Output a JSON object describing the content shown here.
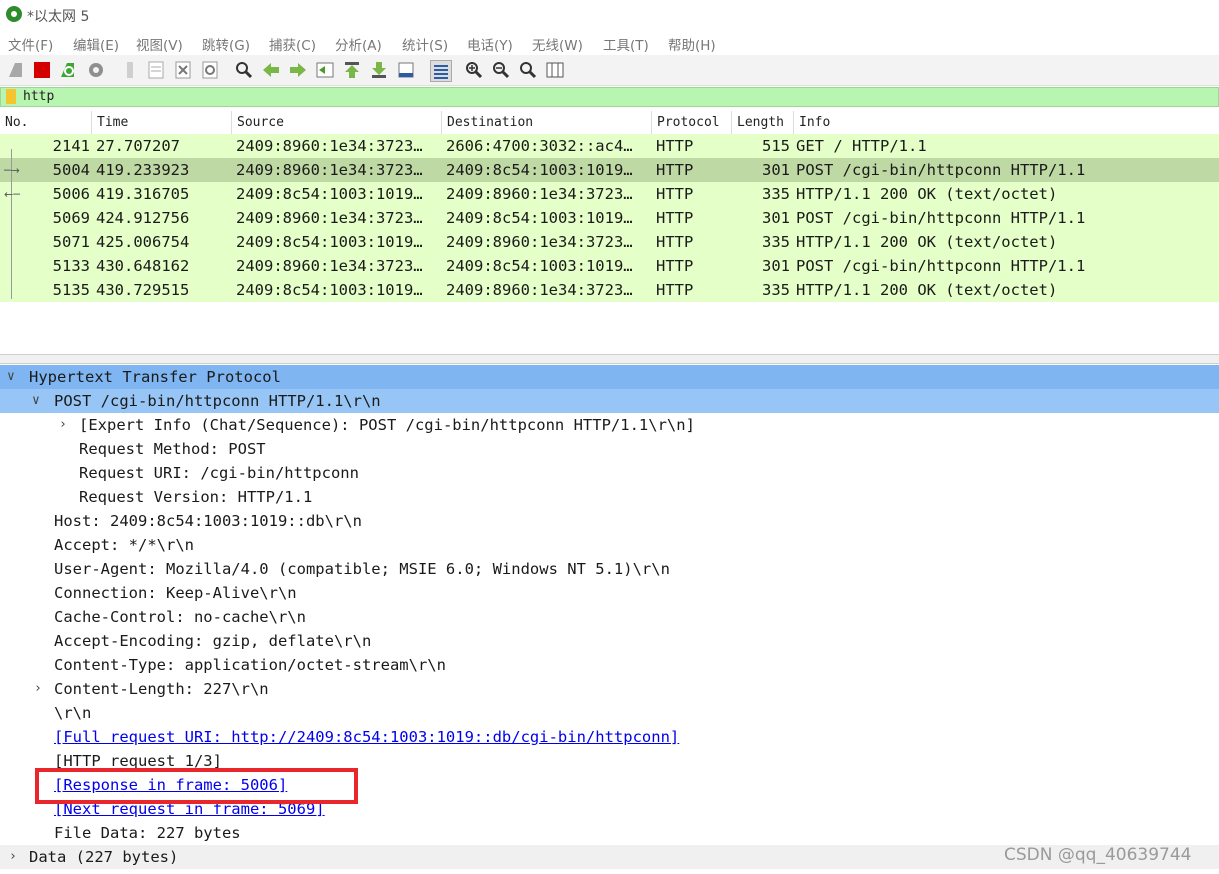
{
  "window": {
    "title": "*以太网 5"
  },
  "menu": [
    "文件(F)",
    "编辑(E)",
    "视图(V)",
    "跳转(G)",
    "捕获(C)",
    "分析(A)",
    "统计(S)",
    "电话(Y)",
    "无线(W)",
    "工具(T)",
    "帮助(H)"
  ],
  "toolbar": {
    "icons": [
      "start-capture-icon",
      "stop-capture-icon",
      "restart-capture-icon",
      "capture-options-icon",
      "open-file-icon",
      "save-file-icon",
      "close-file-icon",
      "reload-file-icon",
      "find-packet-icon",
      "go-back-icon",
      "go-forward-icon",
      "go-to-packet-icon",
      "first-packet-icon",
      "last-packet-icon",
      "autoscroll-icon",
      "colorize-icon",
      "zoom-in-icon",
      "zoom-out-icon",
      "normal-size-icon",
      "resize-columns-icon"
    ]
  },
  "filter": {
    "value": "http"
  },
  "columns": [
    "No.",
    "Time",
    "Source",
    "Destination",
    "Protocol",
    "Length",
    "Info"
  ],
  "packets": [
    {
      "no": "2141",
      "time": "27.707207",
      "source": "2409:8960:1e34:3723…",
      "destination": "2606:4700:3032::ac4…",
      "protocol": "HTTP",
      "length": "515",
      "info": "GET / HTTP/1.1"
    },
    {
      "no": "5004",
      "time": "419.233923",
      "source": "2409:8960:1e34:3723…",
      "destination": "2409:8c54:1003:1019…",
      "protocol": "HTTP",
      "length": "301",
      "info": "POST /cgi-bin/httpconn HTTP/1.1"
    },
    {
      "no": "5006",
      "time": "419.316705",
      "source": "2409:8c54:1003:1019…",
      "destination": "2409:8960:1e34:3723…",
      "protocol": "HTTP",
      "length": "335",
      "info": "HTTP/1.1 200 OK  (text/octet)"
    },
    {
      "no": "5069",
      "time": "424.912756",
      "source": "2409:8960:1e34:3723…",
      "destination": "2409:8c54:1003:1019…",
      "protocol": "HTTP",
      "length": "301",
      "info": "POST /cgi-bin/httpconn HTTP/1.1"
    },
    {
      "no": "5071",
      "time": "425.006754",
      "source": "2409:8c54:1003:1019…",
      "destination": "2409:8960:1e34:3723…",
      "protocol": "HTTP",
      "length": "335",
      "info": "HTTP/1.1 200 OK  (text/octet)"
    },
    {
      "no": "5133",
      "time": "430.648162",
      "source": "2409:8960:1e34:3723…",
      "destination": "2409:8c54:1003:1019…",
      "protocol": "HTTP",
      "length": "301",
      "info": "POST /cgi-bin/httpconn HTTP/1.1"
    },
    {
      "no": "5135",
      "time": "430.729515",
      "source": "2409:8c54:1003:1019…",
      "destination": "2409:8960:1e34:3723…",
      "protocol": "HTTP",
      "length": "335",
      "info": "HTTP/1.1 200 OK  (text/octet)"
    }
  ],
  "detail": {
    "http_header": "Hypertext Transfer Protocol",
    "request_line": "POST /cgi-bin/httpconn HTTP/1.1\\r\\n",
    "expert_info": "[Expert Info (Chat/Sequence): POST /cgi-bin/httpconn HTTP/1.1\\r\\n]",
    "request_method": "Request Method: POST",
    "request_uri": "Request URI: /cgi-bin/httpconn",
    "request_version": "Request Version: HTTP/1.1",
    "host": "Host: 2409:8c54:1003:1019::db\\r\\n",
    "accept": "Accept: */*\\r\\n",
    "user_agent": "User-Agent: Mozilla/4.0 (compatible; MSIE 6.0; Windows NT 5.1)\\r\\n",
    "connection": "Connection: Keep-Alive\\r\\n",
    "cache_control": "Cache-Control: no-cache\\r\\n",
    "accept_encoding": "Accept-Encoding: gzip, deflate\\r\\n",
    "content_type": "Content-Type: application/octet-stream\\r\\n",
    "content_length": "Content-Length: 227\\r\\n",
    "crlf": "\\r\\n",
    "full_uri": "[Full request URI: http://2409:8c54:1003:1019::db/cgi-bin/httpconn]",
    "http_request": "[HTTP request 1/3]",
    "response_in_frame": "[Response in frame: 5006]",
    "next_request": "[Next request in frame: 5069]",
    "file_data": "File Data: 227 bytes",
    "data": "Data (227 bytes)"
  },
  "watermark": "CSDN @qq_40639744",
  "colors": {
    "row_bg": "#e4ffc7",
    "selected_row_bg": "#bfd9a4",
    "highlight": "#7fb6f2",
    "filter_bg": "#b7f5b0",
    "annotation_box": "#e8262b"
  }
}
